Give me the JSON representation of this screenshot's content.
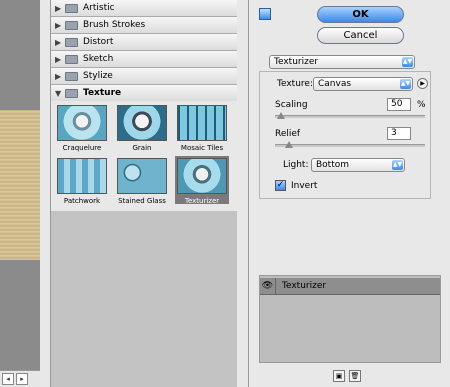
{
  "preview": {
    "scroll_left": "◂",
    "scroll_right": "▸"
  },
  "categories": [
    {
      "label": "Artistic",
      "expanded": false
    },
    {
      "label": "Brush Strokes",
      "expanded": false
    },
    {
      "label": "Distort",
      "expanded": false
    },
    {
      "label": "Sketch",
      "expanded": false
    },
    {
      "label": "Stylize",
      "expanded": false
    },
    {
      "label": "Texture",
      "expanded": true
    }
  ],
  "thumbnails": [
    {
      "label": "Craquelure"
    },
    {
      "label": "Grain"
    },
    {
      "label": "Mosaic Tiles"
    },
    {
      "label": "Patchwork"
    },
    {
      "label": "Stained Glass"
    },
    {
      "label": "Texturizer",
      "selected": true
    }
  ],
  "buttons": {
    "ok": "OK",
    "cancel": "Cancel"
  },
  "filter_select": "Texturizer",
  "settings": {
    "texture_label": "Texture:",
    "texture_value": "Canvas",
    "scaling_label": "Scaling",
    "scaling_value": "50",
    "scaling_unit": "%",
    "relief_label": "Relief",
    "relief_value": "3",
    "light_label": "Light:",
    "light_value": "Bottom",
    "invert_label": "Invert",
    "invert_checked": true
  },
  "layers": [
    {
      "name": "Texturizer"
    }
  ],
  "colors": {
    "accent": "#3b89e8"
  }
}
